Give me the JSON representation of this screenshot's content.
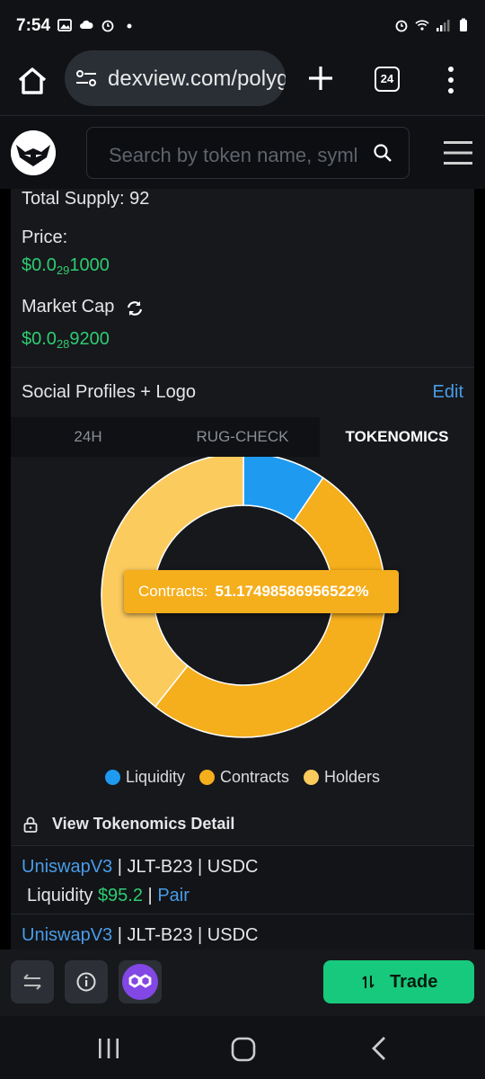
{
  "status_bar": {
    "time": "7:54",
    "left_icons": [
      "image-icon",
      "cloud-icon",
      "alarm-icon",
      "dot-icon"
    ],
    "right_icons": [
      "alarm-icon",
      "wifi-icon",
      "signal-icon",
      "battery-icon"
    ]
  },
  "browser": {
    "url": "dexview.com/polygon",
    "tab_count": "24"
  },
  "site_header": {
    "search_placeholder": "Search by token name, symbol"
  },
  "token_info": {
    "total_supply": "Total Supply: 92",
    "price_label": "Price:",
    "price_prefix": "$0.0",
    "price_zeros": "29",
    "price_digits": "1000",
    "market_cap_label": "Market Cap",
    "market_cap_prefix": "$0.0",
    "market_cap_zeros": "28",
    "market_cap_digits": "9200"
  },
  "social": {
    "title": "Social Profiles + Logo",
    "edit_label": "Edit"
  },
  "tabs": [
    {
      "label": "24H",
      "active": false
    },
    {
      "label": "RUG-CHECK",
      "active": false
    },
    {
      "label": "TOKENOMICS",
      "active": true
    }
  ],
  "tooltip": {
    "label": "Contracts:",
    "value": "51.17498586956522%"
  },
  "chart_data": {
    "type": "pie",
    "donut": true,
    "categories": [
      "Liquidity",
      "Contracts",
      "Holders"
    ],
    "values": [
      9.5,
      51.17498586956522,
      39.33
    ],
    "colors": [
      "#1e9bf0",
      "#f5ae1c",
      "#fccb5e"
    ],
    "legend_position": "bottom"
  },
  "detail_link": "View Tokenomics Detail",
  "pairs": [
    {
      "dex": "UniswapV3",
      "rest": " | JLT-B23 | USDC",
      "liq_label": "Liquidity ",
      "liq_value": "$95.2",
      "sep": " | ",
      "pair_label": "Pair"
    },
    {
      "dex": "UniswapV3",
      "rest": " | JLT-B23 | USDC"
    }
  ],
  "action_bar": {
    "trade_label": "Trade"
  }
}
